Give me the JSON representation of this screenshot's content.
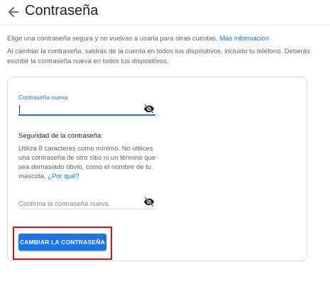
{
  "header": {
    "title": "Contraseña",
    "back_icon": "arrow-back-icon"
  },
  "intro": {
    "line1_text": "Elige una contraseña segura y no vuelvas a usarla para otras cuentas.",
    "line1_link": "Más información",
    "line2_text": "Al cambiar la contraseña, saldrás de la cuenta en todos tus dispositivos, incluido tu teléfono. Deberás escribir la contraseña nueva en todos tus dispositivos."
  },
  "form": {
    "new_password": {
      "label": "Contraseña nueva",
      "value": "",
      "visibility_icon": "eye-off-icon"
    },
    "strength": {
      "title": "Seguridad de la contraseña:",
      "text": "Utiliza 8 caracteres como mínimo. No utilices una contraseña de otro sitio ni un término que sea demasiado obvio, como el nombre de tu mascota.",
      "link": "¿Por qué?"
    },
    "confirm_password": {
      "placeholder": "Confirma la contraseña nueva.",
      "value": "",
      "visibility_icon": "eye-off-icon"
    },
    "submit_label": "CAMBIAR LA CONTRASEÑA"
  },
  "colors": {
    "accent": "#1a73e8",
    "highlight_border": "#d9101b",
    "text_primary": "#202124",
    "text_secondary": "#5f6368"
  }
}
